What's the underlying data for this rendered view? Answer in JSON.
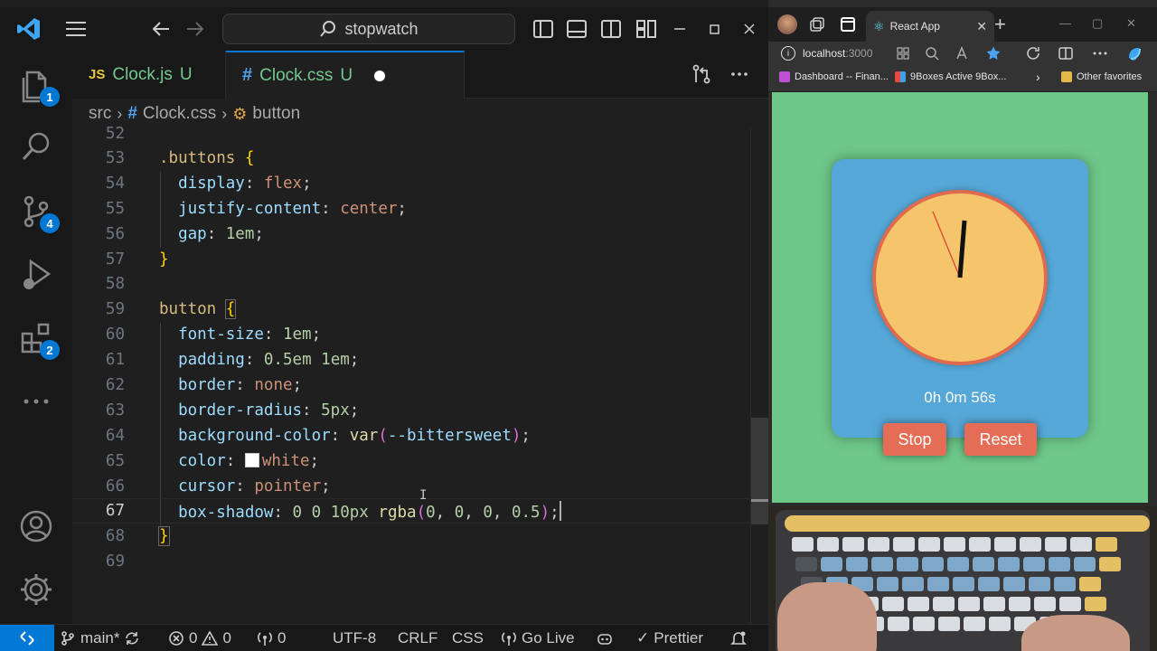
{
  "vscode": {
    "command_center": "stopwatch",
    "activity_badges": {
      "explorer": "1",
      "source_control": "4",
      "extensions": "2"
    },
    "tabs": [
      {
        "icon": "JS",
        "name": "Clock.js",
        "status": "U"
      },
      {
        "icon": "#",
        "name": "Clock.css",
        "status": "U"
      }
    ],
    "breadcrumb": {
      "folder": "src",
      "file": "Clock.css",
      "symbol": "button"
    },
    "line_numbers": [
      "52",
      "53",
      "54",
      "55",
      "56",
      "57",
      "58",
      "59",
      "60",
      "61",
      "62",
      "63",
      "64",
      "65",
      "66",
      "67",
      "68",
      "69"
    ],
    "status_bar": {
      "branch": "main*",
      "errors": "0",
      "warnings": "0",
      "ports": "0",
      "encoding": "UTF-8",
      "eol": "CRLF",
      "language": "CSS",
      "go_live": "Go Live",
      "prettier": "Prettier"
    }
  },
  "browser": {
    "tab_title": "React App",
    "address": "localhost",
    "port": ":3000",
    "favorites": [
      "Dashboard -- Finan...",
      "9Boxes Active 9Box...",
      "Other favorites"
    ],
    "app": {
      "elapsed": "0h 0m 56s",
      "stop_label": "Stop",
      "reset_label": "Reset"
    }
  },
  "colors": {
    "page_bg": "#6ec88a",
    "card_bg": "#56a8d9",
    "clock_face": "#f5c56b",
    "clock_border": "#e06a4e",
    "button_bg": "#e56d55",
    "accent": "#0078d4"
  }
}
